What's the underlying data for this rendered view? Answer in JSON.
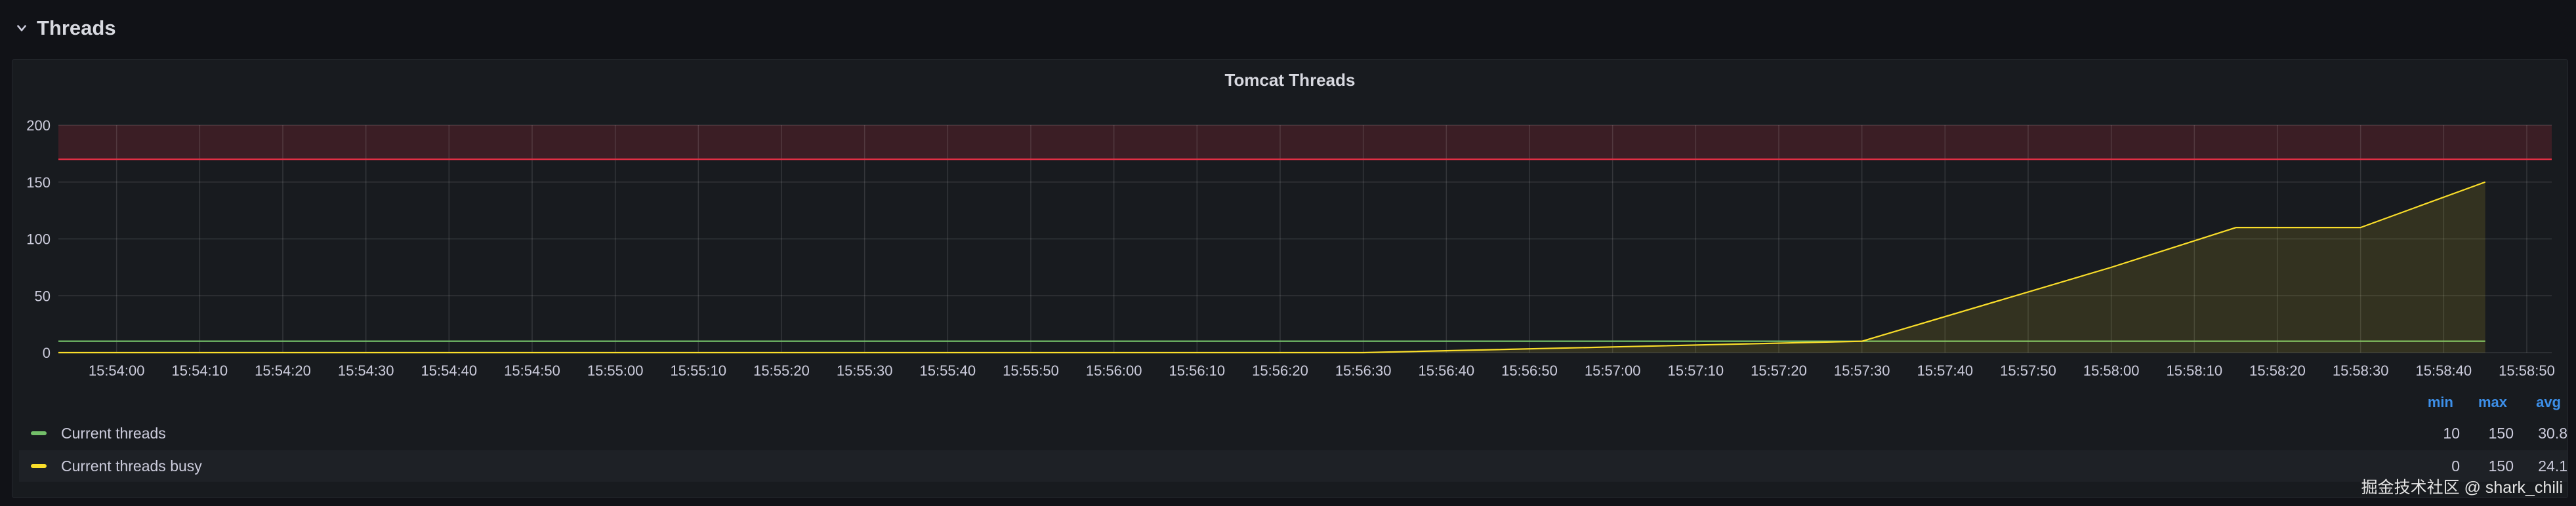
{
  "row": {
    "title": "Threads",
    "chevron_icon": "chevron-down-icon"
  },
  "chart_data": {
    "type": "line",
    "title": "Tomcat Threads",
    "xlabel": "",
    "ylabel": "",
    "ylim": [
      0,
      200
    ],
    "yticks": [
      0,
      50,
      100,
      150,
      200
    ],
    "xlim": [
      "15:53:53",
      "15:58:53"
    ],
    "xticks": [
      "15:54:00",
      "15:54:10",
      "15:54:20",
      "15:54:30",
      "15:54:40",
      "15:54:50",
      "15:55:00",
      "15:55:10",
      "15:55:20",
      "15:55:30",
      "15:55:40",
      "15:55:50",
      "15:56:00",
      "15:56:10",
      "15:56:20",
      "15:56:30",
      "15:56:40",
      "15:56:50",
      "15:57:00",
      "15:57:10",
      "15:57:20",
      "15:57:30",
      "15:57:40",
      "15:57:50",
      "15:58:00",
      "15:58:10",
      "15:58:20",
      "15:58:30",
      "15:58:40",
      "15:58:50"
    ],
    "threshold": {
      "value": 170,
      "color": "#e02f44"
    },
    "grid": true,
    "legend_placement": "bottom",
    "series": [
      {
        "name": "Current threads",
        "color": "#73bf69",
        "x": [
          "15:53:53",
          "15:57:30",
          "15:58:45"
        ],
        "values": [
          10,
          10,
          10
        ],
        "fill": false
      },
      {
        "name": "Current threads busy",
        "color": "#fade2a",
        "x": [
          "15:53:53",
          "15:56:30",
          "15:57:00",
          "15:57:30",
          "15:58:00",
          "15:58:15",
          "15:58:30",
          "15:58:45"
        ],
        "values": [
          0,
          0,
          5,
          10,
          75,
          110,
          110,
          150
        ],
        "fill": true
      }
    ]
  },
  "legend": {
    "headers": {
      "min": "min",
      "max": "max",
      "avg": "avg"
    },
    "rows": [
      {
        "name": "Current threads",
        "color": "#73bf69",
        "min": "10",
        "max": "150",
        "avg": "30.8"
      },
      {
        "name": "Current threads busy",
        "color": "#fade2a",
        "min": "0",
        "max": "150",
        "avg": "24.1"
      }
    ]
  },
  "watermark": "掘金技术社区 @ shark_chili"
}
